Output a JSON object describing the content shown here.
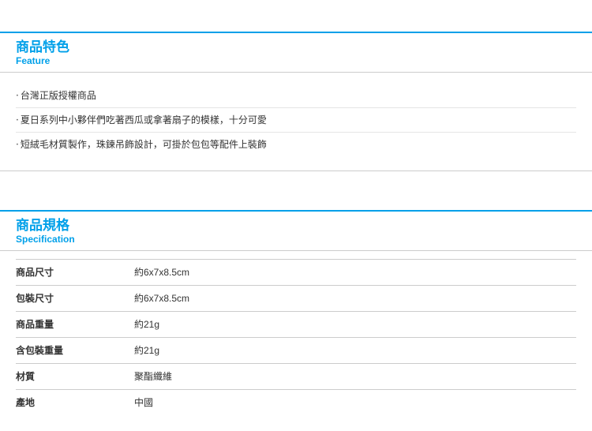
{
  "feature_section": {
    "title_zh": "商品特色",
    "title_en": "Feature",
    "items": [
      "台灣正版授權商品",
      "夏日系列中小夥伴們吃著西瓜或拿著扇子的模樣，十分可愛",
      "短絨毛材質製作，珠鍊吊飾設計，可掛於包包等配件上裝飾"
    ]
  },
  "spec_section": {
    "title_zh": "商品規格",
    "title_en": "Specification",
    "rows": [
      {
        "label": "商品尺寸",
        "value": "約6x7x8.5cm"
      },
      {
        "label": "包裝尺寸",
        "value": "約6x7x8.5cm"
      },
      {
        "label": "商品重量",
        "value": "約21g"
      },
      {
        "label": "含包裝重量",
        "value": "約21g"
      },
      {
        "label": "材質",
        "value": "聚酯纖維"
      },
      {
        "label": "產地",
        "value": "中國"
      }
    ]
  }
}
